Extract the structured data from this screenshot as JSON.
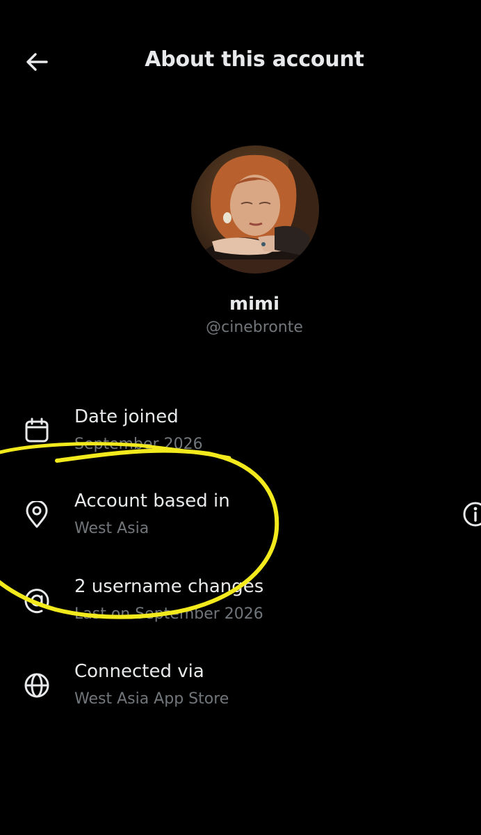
{
  "header": {
    "title": "About this account",
    "back_icon": "arrow-left-icon"
  },
  "profile": {
    "display_name": "mimi",
    "handle": "@cinebronte"
  },
  "details": [
    {
      "icon": "calendar-icon",
      "label": "Date joined",
      "value": "September 2026"
    },
    {
      "icon": "location-pin-icon",
      "label": "Account based in",
      "value": "West Asia"
    },
    {
      "icon": "at-sign-icon",
      "label": "2 username changes",
      "value": "Last on September 2026"
    },
    {
      "icon": "globe-icon",
      "label": "Connected via",
      "value": "West Asia App Store"
    }
  ],
  "colors": {
    "background": "#000000",
    "primary_text": "#e7e9ea",
    "secondary_text": "#71767b",
    "annotation": "#f2ea1d"
  }
}
